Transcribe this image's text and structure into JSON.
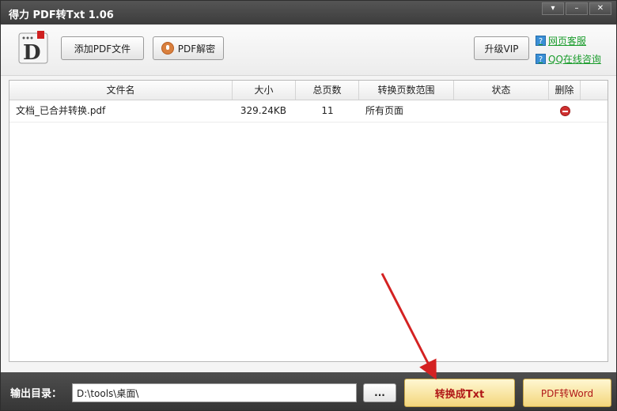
{
  "window": {
    "title": "得力 PDF转Txt 1.06",
    "controls": {
      "menu": "▾",
      "minimize": "–",
      "close": "✕"
    }
  },
  "toolbar": {
    "add_pdf_label": "添加PDF文件",
    "decrypt_label": "PDF解密",
    "vip_label": "升级VIP",
    "web_service_label": "网页客服",
    "qq_service_label": "QQ在线咨询",
    "help_icon_glyph": "?",
    "logo_letter": "D"
  },
  "table": {
    "headers": [
      "文件名",
      "大小",
      "总页数",
      "转换页数范围",
      "状态",
      "删除"
    ],
    "rows": [
      {
        "filename": "文档_已合并转换.pdf",
        "size": "329.24KB",
        "pages": "11",
        "range": "所有页面",
        "status": ""
      }
    ]
  },
  "bottom": {
    "output_label": "输出目录：",
    "output_path": "D:\\tools\\桌面\\",
    "browse_label": "...",
    "convert_label": "转换成Txt",
    "to_word_label": "PDF转Word"
  },
  "colors": {
    "accent_red": "#b01717",
    "link_green": "#1a9c2c",
    "titlebar": "#444444",
    "arrow": "#d42222"
  }
}
